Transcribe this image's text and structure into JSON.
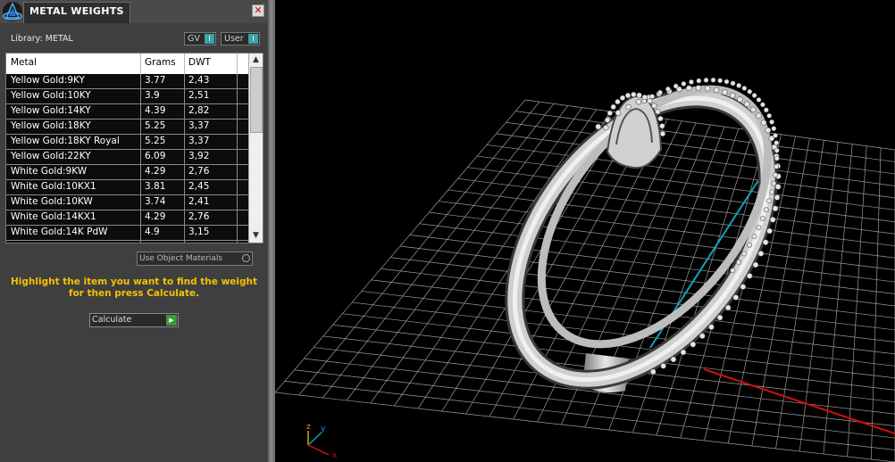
{
  "panel": {
    "title": "METAL WEIGHTS",
    "close_symbol": "✕",
    "library_label": "Library: METAL",
    "toggles": {
      "gv": "GV",
      "user": "User",
      "switch_symbol": "I"
    },
    "table": {
      "headers": [
        "Metal",
        "Grams",
        "DWT"
      ],
      "rows": [
        [
          "Yellow Gold:9KY",
          "3.77",
          "2,43"
        ],
        [
          "Yellow Gold:10KY",
          "3.9",
          "2,51"
        ],
        [
          "Yellow Gold:14KY",
          "4.39",
          "2,82"
        ],
        [
          "Yellow Gold:18KY",
          "5.25",
          "3,37"
        ],
        [
          "Yellow Gold:18KY Royal",
          "5.25",
          "3,37"
        ],
        [
          "Yellow Gold:22KY",
          "6.09",
          "3,92"
        ],
        [
          "White Gold:9KW",
          "4.29",
          "2,76"
        ],
        [
          "White Gold:10KX1",
          "3.81",
          "2,45"
        ],
        [
          "White Gold:10KW",
          "3.74",
          "2,41"
        ],
        [
          "White Gold:14KX1",
          "4.29",
          "2,76"
        ],
        [
          "White Gold:14K PdW",
          "4.9",
          "3,15"
        ]
      ],
      "scroll_up": "▲",
      "scroll_down": "▼"
    },
    "use_object_materials": "Use Object Materials",
    "instructions_line1": "Highlight the item you want to find the weight",
    "instructions_line2": "for then press Calculate.",
    "calculate_label": "Calculate",
    "play_symbol": "▶"
  },
  "viewport": {
    "axes_labels": {
      "z": "z",
      "y": "y",
      "x": "x"
    },
    "colors": {
      "x_axis": "#d01010",
      "y_axis": "#10a0c0",
      "grid": "#9a9a9a",
      "ring": "#d8d8d8"
    },
    "icons": [
      "app-logo-icon",
      "close-icon",
      "play-icon",
      "ring-model"
    ]
  }
}
